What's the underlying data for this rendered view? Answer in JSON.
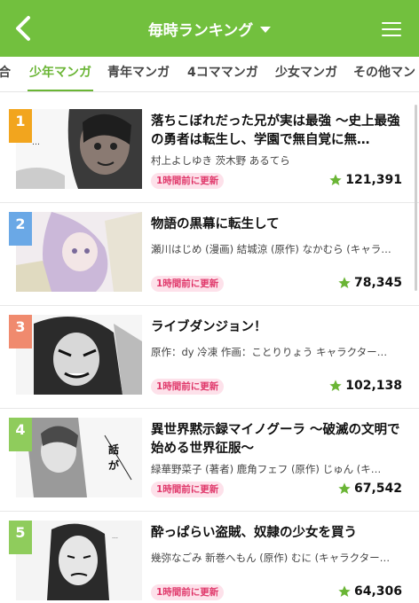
{
  "header": {
    "title": "毎時ランキング",
    "accent": "#72c03e",
    "back_icon": "chevron-left-icon",
    "menu_icon": "hamburger-menu-icon"
  },
  "tabs": [
    {
      "label": "合"
    },
    {
      "label": "少年マンガ",
      "active": true
    },
    {
      "label": "青年マンガ"
    },
    {
      "label": "4コママンガ"
    },
    {
      "label": "少女マンガ"
    },
    {
      "label": "その他マン"
    }
  ],
  "items": [
    {
      "rank": "1",
      "rank_color": "#f2a51e",
      "title": "落ちこぼれだった兄が実は最強 〜史上最強の勇者は転生し、学園で無自覚に無…",
      "author": "村上よしゆき 茨木野 あるてら",
      "badge": "1時間前に更新",
      "rating": "121,391"
    },
    {
      "rank": "2",
      "rank_color": "#6aa8e6",
      "title": "物語の黒幕に転生して",
      "author": "瀬川はじめ (漫画) 結城涼 (原作) なかむら (キャラ…",
      "badge": "1時間前に更新",
      "rating": "78,345"
    },
    {
      "rank": "3",
      "rank_color": "#f08a6e",
      "title": "ライブダンジョン！",
      "author": "原作：dy 冷凍 作画：ことりりょう キャラクター…",
      "badge": "1時間前に更新",
      "rating": "102,138"
    },
    {
      "rank": "4",
      "rank_color": "#8fcc5c",
      "title": "異世界黙示録マイノグーラ 〜破滅の文明で始める世界征服〜",
      "author": "緑華野菜子 (著者) 鹿角フェフ (原作) じゅん (キ…",
      "badge": "1時間前に更新",
      "rating": "67,542"
    },
    {
      "rank": "5",
      "rank_color": "#8fcc5c",
      "title": "酔っぱらい盗賊、奴隷の少女を買う",
      "author": "幾弥なごみ 新巻へもん (原作) むに (キャラクター…",
      "badge": "1時間前に更新",
      "rating": "64,306"
    }
  ]
}
